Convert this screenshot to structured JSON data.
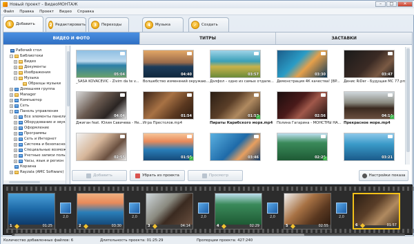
{
  "window": {
    "title": "Новый проект - ВидеоМОНТАЖ",
    "controls": [
      "–",
      "□",
      "✕"
    ]
  },
  "menu": [
    "Файл",
    "Правка",
    "Проект",
    "Видео",
    "Справка"
  ],
  "steps": [
    {
      "num": "1",
      "label": "Добавить"
    },
    {
      "num": "2",
      "label": "Редактировать"
    },
    {
      "num": "3",
      "label": "Переходы"
    },
    {
      "num": "4",
      "label": "Музыка"
    },
    {
      "num": "✓",
      "label": "Создать"
    }
  ],
  "tabs": [
    "ВИДЕО И ФОТО",
    "ТИТРЫ",
    "ЗАСТАВКИ"
  ],
  "tree": [
    {
      "label": "Рабочий стол",
      "indent": 0,
      "exp": "",
      "icon": "desk"
    },
    {
      "label": "Библиотеки",
      "indent": 1,
      "exp": "−",
      "icon": "folder"
    },
    {
      "label": "Видео",
      "indent": 2,
      "exp": "+",
      "icon": "folder"
    },
    {
      "label": "Документы",
      "indent": 2,
      "exp": "+",
      "icon": "folder"
    },
    {
      "label": "Изображения",
      "indent": 2,
      "exp": "+",
      "icon": "folder"
    },
    {
      "label": "Музыка",
      "indent": 2,
      "exp": "−",
      "icon": "folder"
    },
    {
      "label": "Образцы музыки",
      "indent": 3,
      "exp": "",
      "icon": "folder"
    },
    {
      "label": "Домашняя группа",
      "indent": 1,
      "exp": "+",
      "icon": "blue"
    },
    {
      "label": "Manager",
      "indent": 1,
      "exp": "+",
      "icon": "folder"
    },
    {
      "label": "Компьютер",
      "indent": 1,
      "exp": "+",
      "icon": "blue"
    },
    {
      "label": "Сеть",
      "indent": 1,
      "exp": "+",
      "icon": "blue"
    },
    {
      "label": "Панель управления",
      "indent": 1,
      "exp": "−",
      "icon": "blue"
    },
    {
      "label": "Все элементы панели",
      "indent": 2,
      "exp": "+",
      "icon": "blue"
    },
    {
      "label": "Оборудование и звук",
      "indent": 2,
      "exp": "+",
      "icon": "blue"
    },
    {
      "label": "Оформление",
      "indent": 2,
      "exp": "+",
      "icon": "blue"
    },
    {
      "label": "Программы",
      "indent": 2,
      "exp": "+",
      "icon": "blue"
    },
    {
      "label": "Сеть и Интернет",
      "indent": 2,
      "exp": "+",
      "icon": "blue"
    },
    {
      "label": "Система и безопасность",
      "indent": 2,
      "exp": "+",
      "icon": "blue"
    },
    {
      "label": "Специальные возможности",
      "indent": 2,
      "exp": "+",
      "icon": "blue"
    },
    {
      "label": "Учетные записи пользователей",
      "indent": 2,
      "exp": "+",
      "icon": "blue"
    },
    {
      "label": "Часы, язык и регион",
      "indent": 2,
      "exp": "+",
      "icon": "blue"
    },
    {
      "label": "Корзина",
      "indent": 1,
      "exp": "",
      "icon": "blue"
    },
    {
      "label": "Rayzala (АМС Software)",
      "indent": 1,
      "exp": "+",
      "icon": "folder"
    }
  ],
  "media": [
    {
      "caption": "_SASA KOVACEVIC - Zivim da te v...",
      "duration": "05:04",
      "check": false,
      "bold": false,
      "bg": "linear-gradient(180deg,#8fbfe3 0%,#bcd9ee 40%,#2d7fa8 55%,#6aa06a 100%)"
    },
    {
      "caption": "Волшебство изменений окружаю...",
      "duration": "04:40",
      "check": false,
      "bold": false,
      "bg": "linear-gradient(180deg,#e3a766 0%,#9a6a4a 45%,#1d3c5a 60%,#10283e 100%)"
    },
    {
      "caption": "Дэлфол – одно из самых отдале...",
      "duration": "03:57",
      "check": false,
      "bold": false,
      "bg": "linear-gradient(180deg,#9fd3e8 0%,#3aa0b8 40%,#c8b24a 60%,#6a8a3a 100%)"
    },
    {
      "caption": "Демонстрация 4К качества! [BP...",
      "duration": "03:30",
      "check": false,
      "bold": false,
      "bg": "linear-gradient(135deg,#1c5d8a 0%,#2a9cc6 40%,#e6a04a 60%,#0f3a5a 100%)"
    },
    {
      "caption": "Денис RiDer - Будущая МС 77.pro...",
      "duration": "03:47",
      "check": false,
      "bold": false,
      "bg": "linear-gradient(135deg,#1a1a1a 0%,#3a2a24 50%,#7a5a44 75%,#1a1a1a 100%)"
    },
    {
      "caption": "Джиган feat. Юлия Савичева - Не...",
      "duration": "04:04",
      "check": false,
      "bold": false,
      "bg": "linear-gradient(135deg,#d8d8d8 0%,#6a5a50 40%,#2a2422 70%,#e0e0e0 100%)"
    },
    {
      "caption": "Игра Престолов.mp4",
      "duration": "01:54",
      "check": false,
      "bold": false,
      "bg": "linear-gradient(135deg,#3a2418 0%,#a87244 40%,#5a3820 70%,#2a1a10 100%)"
    },
    {
      "caption": "Пираты Карибского моря.mp4",
      "duration": "01:57",
      "check": true,
      "bold": true,
      "bg": "linear-gradient(135deg,#2a1e14 0%,#5a3e28 40%,#b08a60 65%,#3a2a1c 100%)"
    },
    {
      "caption": "Полина Гагарина - МОНСТРЫ НА...",
      "duration": "02:56",
      "check": false,
      "bold": false,
      "bg": "linear-gradient(135deg,#1a0e0e 0%,#4a1a1a 40%,#a0584a 60%,#1a0e0e 100%)"
    },
    {
      "caption": "Прекрасное море.mp4",
      "duration": "04:14",
      "check": true,
      "bold": true,
      "bg": "linear-gradient(180deg,#d0d8dc 0%,#8a8a80 40%,#3a2a20 60%,#6a5040 100%)"
    },
    {
      "caption": "",
      "duration": "02:55",
      "check": false,
      "bold": false,
      "bg": "linear-gradient(135deg,#f2f2f2 0%,#d6b69a 40%,#6a5040 70%,#e8e8e8 100%)"
    },
    {
      "caption": "",
      "duration": "01:50",
      "check": true,
      "bold": false,
      "bg": "linear-gradient(180deg,#f7c69a 0%,#e88a5a 30%,#2a7eb8 60%,#154a7a 100%)"
    },
    {
      "caption": "",
      "duration": "03:46",
      "check": false,
      "bold": false,
      "bg": "linear-gradient(135deg,#5ab0e0 0%,#1e6aa8 50%,#e8a060 70%,#0e3a6a 100%)"
    },
    {
      "caption": "",
      "duration": "02:29",
      "check": true,
      "bold": false,
      "bg": "linear-gradient(180deg,#bfe0f0 0%,#3a8a5a 35%,#1e5a34 100%)"
    },
    {
      "caption": "",
      "duration": "03:21",
      "check": false,
      "bold": false,
      "bg": "linear-gradient(180deg,#8ec8ea 0%,#3a9ac8 40%,#1a5a8a 100%)"
    }
  ],
  "buttons": {
    "add": "Добавить",
    "remove": "Убрать из проекта",
    "preview": "Просмотр",
    "settings": "Настройки показа"
  },
  "timeline": {
    "clips": [
      {
        "num": "1",
        "dur": "01:25",
        "bg": "linear-gradient(180deg,#4aa0d8 0%,#1e6aa8 50%,#0e3a6a 100%)",
        "sel": false
      },
      {
        "num": "2",
        "dur": "03:30",
        "bg": "linear-gradient(180deg,#f0b080 0%,#e88a5a 30%,#2a7eb8 60%,#154a7a 100%)",
        "sel": false
      },
      {
        "num": "3",
        "dur": "04:14",
        "bg": "linear-gradient(135deg,#d0d8dc 0%,#8a8a80 40%,#3a2a20 60%,#6a5040 100%)",
        "sel": false
      },
      {
        "num": "4",
        "dur": "02:29",
        "bg": "linear-gradient(180deg,#bfe0f0 0%,#3a8a5a 35%,#1e5a34 100%)",
        "sel": false
      },
      {
        "num": "5",
        "dur": "02:55",
        "bg": "linear-gradient(135deg,#f2f2f2 0%,#a87244 40%,#5a3820 70%,#2a1a10 100%)",
        "sel": false
      },
      {
        "num": "6",
        "dur": "01:57",
        "bg": "linear-gradient(135deg,#2a1e14 0%,#5a3e28 40%,#b08a60 65%,#3a2a1c 100%)",
        "sel": true
      }
    ],
    "transition_value": "2,0"
  },
  "status": {
    "count": "Количество добавленных файлов: 6",
    "duration": "Длительность проекта: 01:25:29",
    "ratio": "Пропорции проекта: 427:240"
  }
}
